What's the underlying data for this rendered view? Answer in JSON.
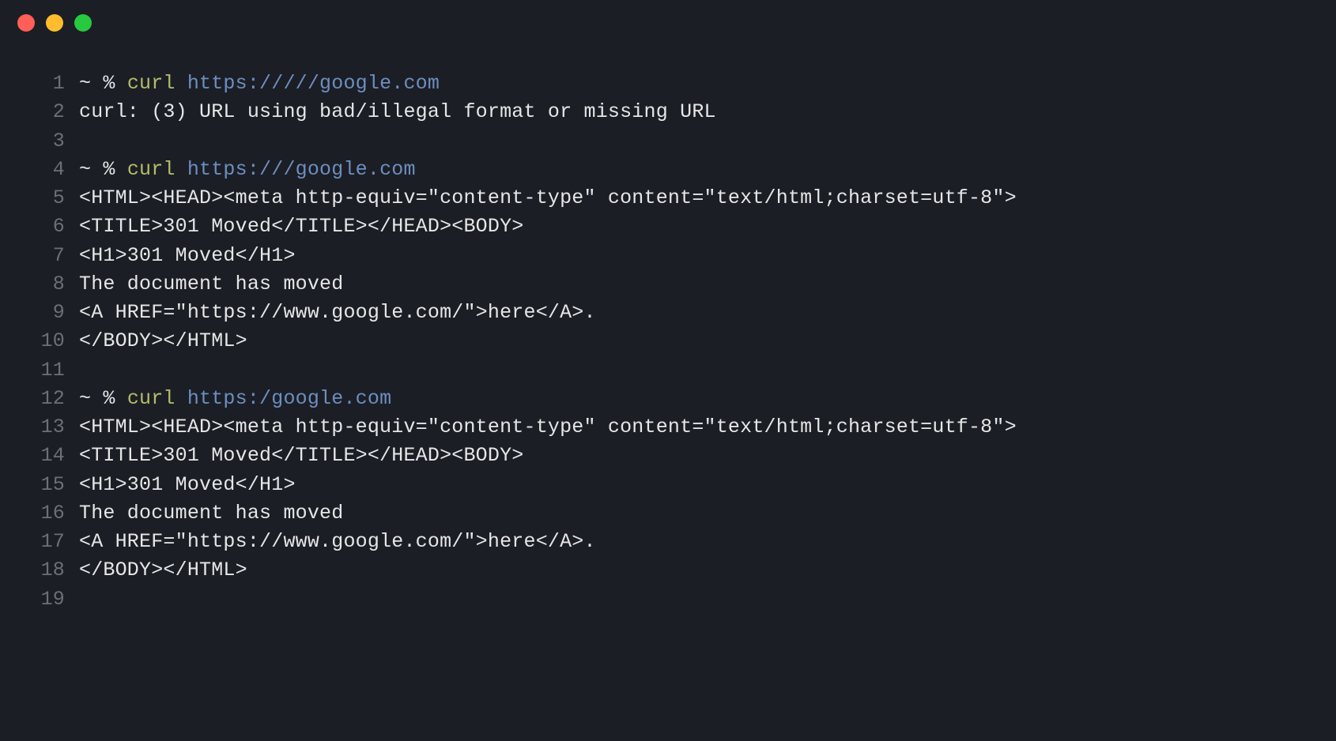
{
  "lines": [
    {
      "num": "1",
      "segments": [
        {
          "cls": "plain",
          "text": "~ % "
        },
        {
          "cls": "cmd",
          "text": "curl "
        },
        {
          "cls": "url",
          "text": "https://///google.com"
        }
      ]
    },
    {
      "num": "2",
      "segments": [
        {
          "cls": "plain",
          "text": "curl: (3) URL using bad/illegal format or missing URL"
        }
      ]
    },
    {
      "num": "3",
      "segments": [
        {
          "cls": "plain",
          "text": ""
        }
      ]
    },
    {
      "num": "4",
      "segments": [
        {
          "cls": "plain",
          "text": "~ % "
        },
        {
          "cls": "cmd",
          "text": "curl "
        },
        {
          "cls": "url",
          "text": "https:///google.com"
        }
      ]
    },
    {
      "num": "5",
      "segments": [
        {
          "cls": "plain",
          "text": "<HTML><HEAD><meta http-equiv=\"content-type\" content=\"text/html;charset=utf-8\">"
        }
      ]
    },
    {
      "num": "6",
      "segments": [
        {
          "cls": "plain",
          "text": "<TITLE>301 Moved</TITLE></HEAD><BODY>"
        }
      ]
    },
    {
      "num": "7",
      "segments": [
        {
          "cls": "plain",
          "text": "<H1>301 Moved</H1>"
        }
      ]
    },
    {
      "num": "8",
      "segments": [
        {
          "cls": "plain",
          "text": "The document has moved"
        }
      ]
    },
    {
      "num": "9",
      "segments": [
        {
          "cls": "plain",
          "text": "<A HREF=\"https://www.google.com/\">here</A>."
        }
      ]
    },
    {
      "num": "10",
      "segments": [
        {
          "cls": "plain",
          "text": "</BODY></HTML>"
        }
      ]
    },
    {
      "num": "11",
      "segments": [
        {
          "cls": "plain",
          "text": ""
        }
      ]
    },
    {
      "num": "12",
      "segments": [
        {
          "cls": "plain",
          "text": "~ % "
        },
        {
          "cls": "cmd",
          "text": "curl "
        },
        {
          "cls": "url",
          "text": "https:/google.com"
        }
      ]
    },
    {
      "num": "13",
      "segments": [
        {
          "cls": "plain",
          "text": "<HTML><HEAD><meta http-equiv=\"content-type\" content=\"text/html;charset=utf-8\">"
        }
      ]
    },
    {
      "num": "14",
      "segments": [
        {
          "cls": "plain",
          "text": "<TITLE>301 Moved</TITLE></HEAD><BODY>"
        }
      ]
    },
    {
      "num": "15",
      "segments": [
        {
          "cls": "plain",
          "text": "<H1>301 Moved</H1>"
        }
      ]
    },
    {
      "num": "16",
      "segments": [
        {
          "cls": "plain",
          "text": "The document has moved"
        }
      ]
    },
    {
      "num": "17",
      "segments": [
        {
          "cls": "plain",
          "text": "<A HREF=\"https://www.google.com/\">here</A>."
        }
      ]
    },
    {
      "num": "18",
      "segments": [
        {
          "cls": "plain",
          "text": "</BODY></HTML>"
        }
      ]
    },
    {
      "num": "19",
      "segments": [
        {
          "cls": "plain",
          "text": ""
        }
      ]
    }
  ]
}
